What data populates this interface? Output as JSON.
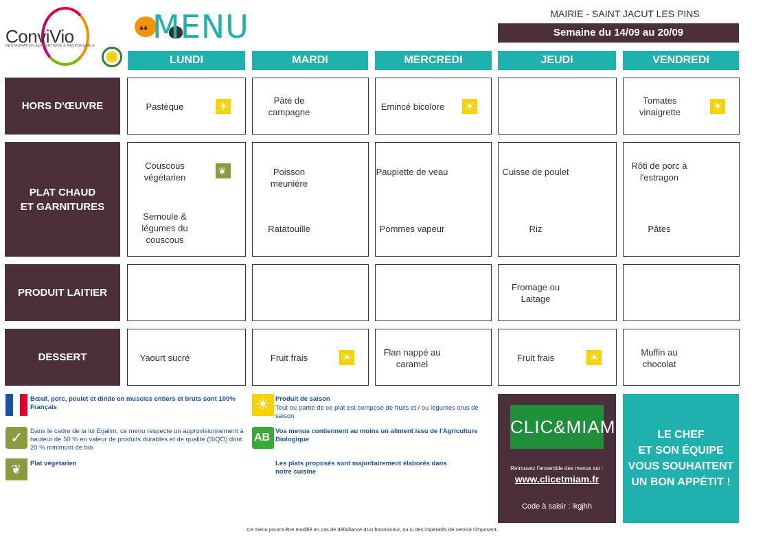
{
  "brand": {
    "name": "ConviVio",
    "tagline": "RESTAURATION AUTHENTIQUE & RESPONSABLE"
  },
  "header": {
    "title": "MENU",
    "location": "MAIRIE - SAINT JACUT LES PINS",
    "week": "Semaine du 14/09 au 20/09"
  },
  "days": [
    "LUNDI",
    "MARDI",
    "MERCREDI",
    "JEUDI",
    "VENDREDI"
  ],
  "rows": [
    {
      "label": "HORS D'ŒUVRE"
    },
    {
      "label": "PLAT CHAUD\nET GARNITURES"
    },
    {
      "label": "PRODUIT LAITIER"
    },
    {
      "label": "DESSERT"
    }
  ],
  "cells": {
    "hors_oeuvre": {
      "lundi": "Pastèque",
      "mardi": "Pâté de\ncampagne",
      "mercredi": "Emincé bicolore",
      "jeudi": "",
      "vendredi": "Tomates\nvinaigrette"
    },
    "plat": {
      "lundi_main": "Couscous\nvégétarien",
      "lundi_side": "Semoule &\nlégumes du\ncouscous",
      "mardi_main": "Poisson meunière",
      "mardi_side": "Ratatouille",
      "mercredi_main": "Paupiette de veau",
      "mercredi_side": "Pommes vapeur",
      "jeudi_main": "Cuisse de poulet",
      "jeudi_side": "Riz",
      "vendredi_main": "Rôti de porc à\nl'estragon",
      "vendredi_side": "Pâtes"
    },
    "laitier": {
      "jeudi": "Fromage ou\nLaitage"
    },
    "dessert": {
      "lundi": "Yaourt sucré",
      "mardi": "Fruit frais",
      "mercredi": "Flan nappé au\ncaramel",
      "jeudi": "Fruit frais",
      "vendredi": "Muffin au\nchocolat"
    }
  },
  "legend": {
    "france": "Bœuf, porc, poulet et dinde en muscles entiers et bruts sont 100% Français",
    "egalim": "Dans le cadre de la loi Egalim, ce menu respecte un approvisionnement à hauteur de 50 % en valeur de produits durables et de qualité (SIQO) dont 20 % minimum de bio",
    "vegetarien": "Plat végétarien",
    "saison_title": "Produit de saison",
    "saison_text": "Tout ou partie de ce plat est composé de fruits et / ou légumes crus de saison",
    "bio": "Vos menus contiennent au moins un aliment issu de l'Agriculture Biologique",
    "maison": "Les plats proposés sont majoritairement élaborés dans notre cuisine"
  },
  "clicmiam": {
    "logo": "CLIC&MIAM!",
    "info": "Retrouvez l'ensemble des menus sur :",
    "url": "www.clicetmiam.fr",
    "code": "Code à saisir : lkgjhh"
  },
  "chef_message": "LE CHEF\nET SON ÉQUIPE\nVOUS SOUHAITENT\nUN BON APPÉTIT !",
  "footer": "Ce menu pourra être modifié en cas de défaillance d'un fournisseur, ou si des impératifs de service l'imposent.",
  "colors": {
    "teal": "#1fb1ad",
    "plum": "#4b2f3b",
    "sun": "#f6d300",
    "veg": "#8a9a3e",
    "legend_text": "#1d4fa3"
  },
  "icons": {
    "season": "sun-icon",
    "vegetarian": "leaf-icon",
    "bio": "ab-icon",
    "egalim": "check-icon",
    "origin": "france-flag-icon"
  }
}
